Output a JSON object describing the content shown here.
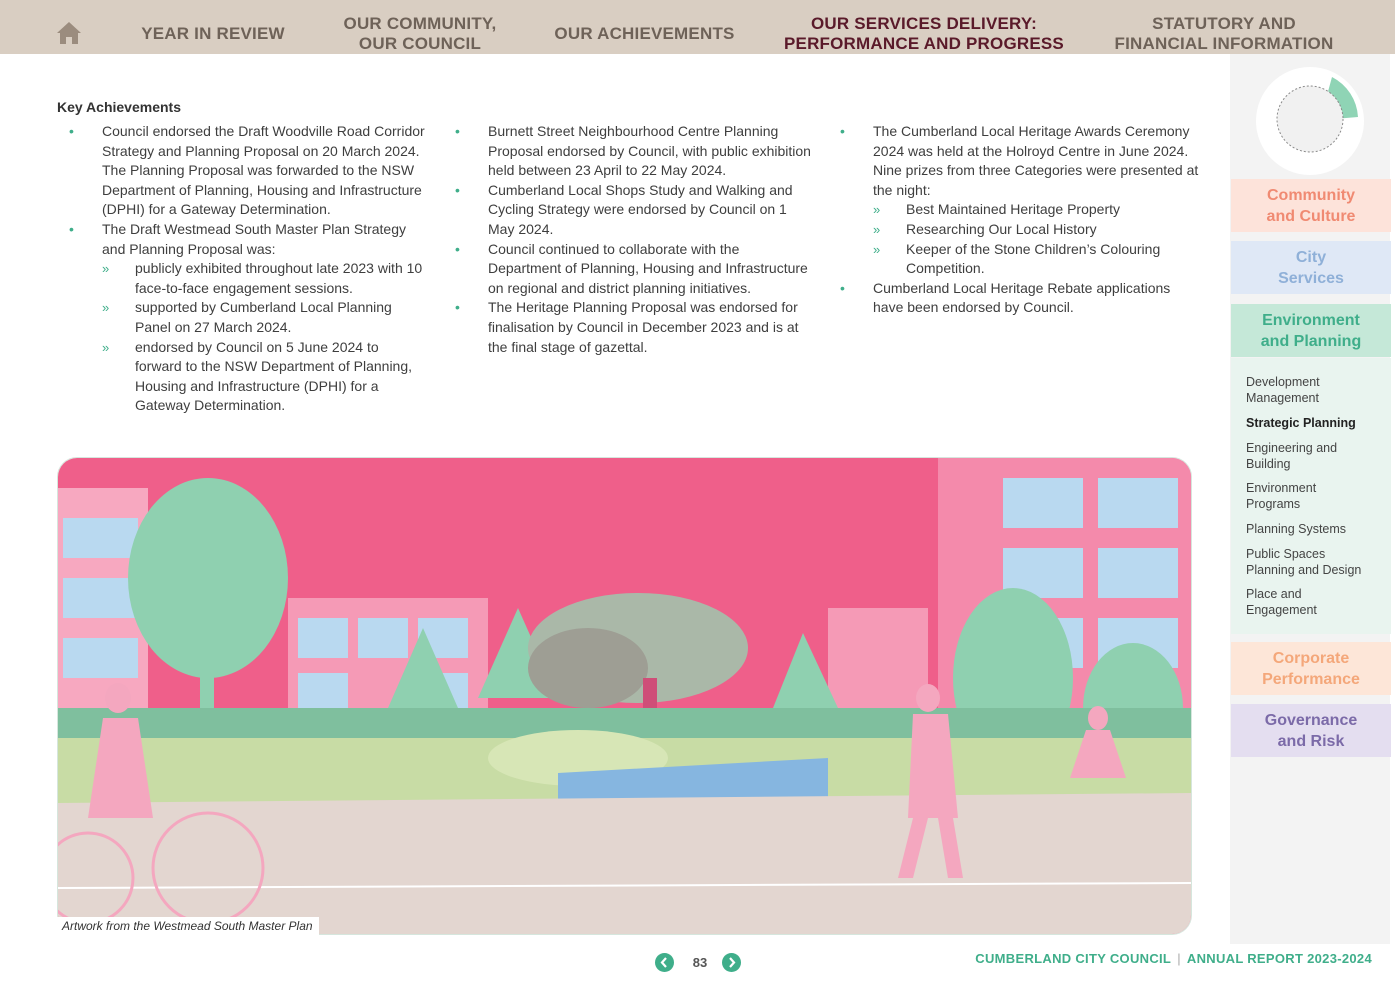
{
  "nav": {
    "items": [
      {
        "label": "YEAR IN REVIEW"
      },
      {
        "line1": "OUR COMMUNITY,",
        "line2": "OUR COUNCIL"
      },
      {
        "label": "OUR ACHIEVEMENTS"
      },
      {
        "line1": "OUR SERVICES DELIVERY:",
        "line2": "PERFORMANCE AND PROGRESS"
      },
      {
        "line1": "STATUTORY AND",
        "line2": "FINANCIAL INFORMATION"
      }
    ]
  },
  "content": {
    "heading": "Key Achievements",
    "col1": {
      "b1": "Council endorsed the Draft Woodville Road Corridor Strategy and Planning Proposal on 20 March 2024. The Planning Proposal was forwarded to the NSW Department of Planning, Housing and Infrastructure (DPHI) for a Gateway Determination.",
      "b2": "The Draft Westmead South Master Plan Strategy and Planning Proposal was:",
      "s1": "publicly exhibited throughout late 2023 with 10 face-to-face engagement sessions.",
      "s2": "supported by Cumberland Local Planning Panel on 27 March 2024.",
      "s3": "endorsed by Council on 5 June 2024 to forward to the NSW Department of Planning, Housing and Infrastructure (DPHI) for a Gateway Determination."
    },
    "col2": {
      "b1": "Burnett Street Neighbourhood Centre Planning Proposal endorsed by Council, with public exhibition held between 23 April to 22 May 2024.",
      "b2": "Cumberland Local Shops Study and Walking and Cycling Strategy were endorsed by Council on 1 May 2024.",
      "b3": "Council continued to collaborate with the Department of Planning, Housing and Infrastructure on regional and district planning initiatives.",
      "b4": "The Heritage Planning Proposal was endorsed for finalisation by Council in December 2023 and is at the final stage of gazettal."
    },
    "col3": {
      "b1": "The Cumberland Local Heritage Awards Ceremony 2024 was held at the Holroyd Centre in June 2024. Nine prizes from three Categories were presented at the night:",
      "s1": "Best Maintained Heritage Property",
      "s2": "Researching Our Local History",
      "s3": "Keeper of the Stone Children’s Colouring Competition.",
      "b2": "Cumberland Local Heritage Rebate applications have been endorsed by Council."
    }
  },
  "artwork": {
    "caption": "Artwork from the Westmead South Master Plan"
  },
  "footer": {
    "page_number": "83",
    "org": "CUMBERLAND CITY COUNCIL",
    "separator": "|",
    "report": "ANNUAL REPORT 2023-2024"
  },
  "sidebar": {
    "sections": {
      "community": {
        "line1": "Community",
        "line2": "and Culture"
      },
      "city": {
        "line1": "City",
        "line2": "Services"
      },
      "environment": {
        "line1": "Environment",
        "line2": "and Planning"
      },
      "corporate": {
        "line1": "Corporate",
        "line2": "Performance"
      },
      "governance": {
        "line1": "Governance",
        "line2": "and Risk"
      }
    },
    "subitems": {
      "dev": {
        "line1": "Development",
        "line2": "Management"
      },
      "strategic": {
        "label": "Strategic Planning"
      },
      "eng": {
        "line1": "Engineering and",
        "line2": "Building"
      },
      "envprog": {
        "line1": "Environment",
        "line2": "Programs"
      },
      "psys": {
        "label": "Planning Systems"
      },
      "pub": {
        "line1": "Public Spaces",
        "line2": "Planning and Design"
      },
      "place": {
        "line1": "Place and",
        "line2": "Engagement"
      }
    }
  },
  "colors": {
    "accent": "#3fae8a",
    "nav_bg": "#d9cec2",
    "community": "#f08a72",
    "city": "#8fb0d8",
    "environment": "#3fae8a",
    "corporate": "#f4a77a",
    "governance": "#7b6aa8",
    "artwork_pink": "#ef5f8a"
  }
}
